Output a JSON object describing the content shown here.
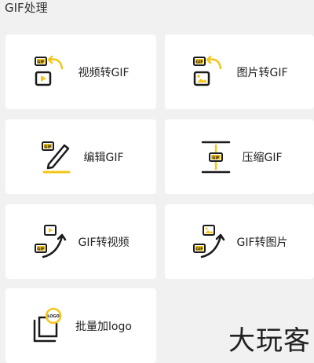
{
  "section": {
    "title": "GIF处理"
  },
  "cards": [
    {
      "label": "视频转GIF",
      "icon": "video-to-gif-icon"
    },
    {
      "label": "图片转GIF",
      "icon": "image-to-gif-icon"
    },
    {
      "label": "编辑GIF",
      "icon": "edit-gif-icon"
    },
    {
      "label": "压缩GIF",
      "icon": "compress-gif-icon"
    },
    {
      "label": "GIF转视频",
      "icon": "gif-to-video-icon"
    },
    {
      "label": "GIF转图片",
      "icon": "gif-to-image-icon"
    },
    {
      "label": "批量加logo",
      "icon": "batch-logo-icon"
    }
  ],
  "watermark": {
    "text": "大玩客"
  },
  "colors": {
    "accent": "#f5c518",
    "ink": "#1a1a1a",
    "background": "#f1f1f1",
    "card": "#ffffff"
  }
}
